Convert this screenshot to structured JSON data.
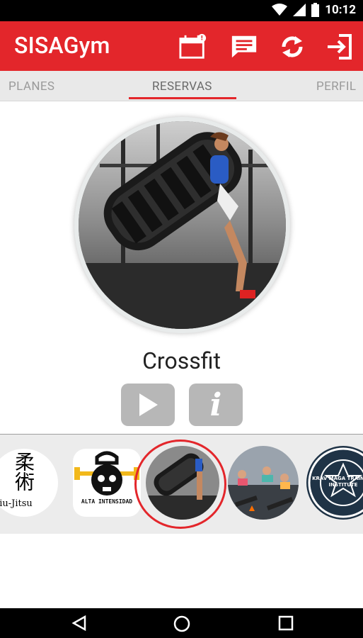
{
  "status_bar": {
    "time": "10:12"
  },
  "app": {
    "title": "SISAGym",
    "accent": "#e3262b",
    "calendar_badge": "!"
  },
  "actions": [
    {
      "name": "calendar-icon"
    },
    {
      "name": "message-icon"
    },
    {
      "name": "refresh-icon"
    },
    {
      "name": "logout-icon"
    }
  ],
  "tabs": [
    {
      "label": "PLANES",
      "active": false
    },
    {
      "label": "RESERVAS",
      "active": true
    },
    {
      "label": "PERFIL",
      "active": false
    }
  ],
  "selected_class": {
    "name": "Crossfit"
  },
  "buttons": {
    "play": "play-icon",
    "info": "i"
  },
  "carousel": {
    "items": [
      {
        "label": "Jiu-Jitsu",
        "kanji": "柔術"
      },
      {
        "label": "ALTA INTENSIDAD"
      },
      {
        "label": "Crossfit",
        "selected": true
      },
      {
        "label": ""
      },
      {
        "label": "KRAV MAGA TRAINING INSTITUTE"
      }
    ]
  }
}
